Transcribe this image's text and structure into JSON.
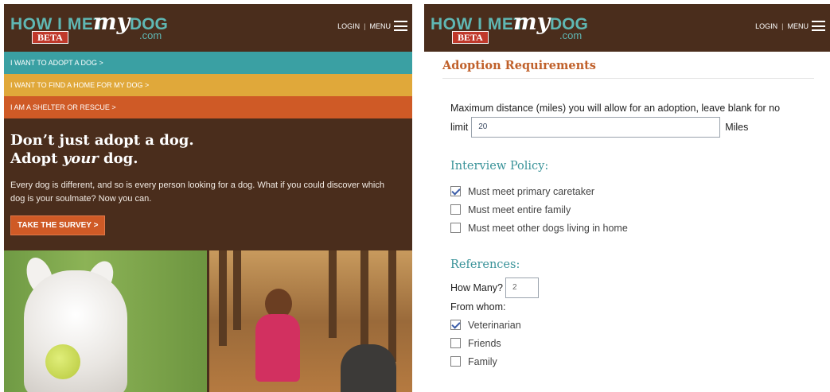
{
  "logo": {
    "how_i_met": "HOW I MET",
    "my": "my",
    "dog": "DOG",
    "com": ".com",
    "beta": "BETA"
  },
  "header": {
    "login": "LOGIN",
    "separator": "|",
    "menu": "MENU"
  },
  "nav_bands": [
    {
      "label": "I WANT TO ADOPT A DOG >",
      "color": "#3aa0a3"
    },
    {
      "label": "I WANT TO FIND A HOME FOR MY DOG >",
      "color": "#e0a83a"
    },
    {
      "label": "I AM A SHELTER OR RESCUE >",
      "color": "#cf5a26"
    }
  ],
  "hero": {
    "line1": "Don’t just adopt a dog.",
    "line2_pre": "Adopt ",
    "line2_em": "your",
    "line2_post": " dog.",
    "body": "Every dog is different, and so is every person looking for a dog. What if you could discover which dog is your soulmate? Now you can.",
    "cta": "TAKE THE SURVEY >"
  },
  "right": {
    "section_title": "Adoption Requirements",
    "distance": {
      "label": "Maximum distance (miles) you will allow for an adoption, leave blank for no",
      "label_cont": "limit",
      "value": "20",
      "unit": "Miles"
    },
    "interview": {
      "title": "Interview Policy:",
      "options": [
        {
          "label": "Must meet primary caretaker",
          "checked": true
        },
        {
          "label": "Must meet entire family",
          "checked": false
        },
        {
          "label": "Must meet other dogs living in home",
          "checked": false
        }
      ]
    },
    "references": {
      "title": "References:",
      "how_many_label": "How Many?",
      "how_many_value": "2",
      "from_whom_label": "From whom:",
      "options": [
        {
          "label": "Veterinarian",
          "checked": true
        },
        {
          "label": "Friends",
          "checked": false
        },
        {
          "label": "Family",
          "checked": false
        }
      ]
    }
  },
  "colors": {
    "brand_brown": "#4a2d1c",
    "teal": "#3aa0a3",
    "gold": "#e0a83a",
    "orange": "#cf5a26"
  }
}
